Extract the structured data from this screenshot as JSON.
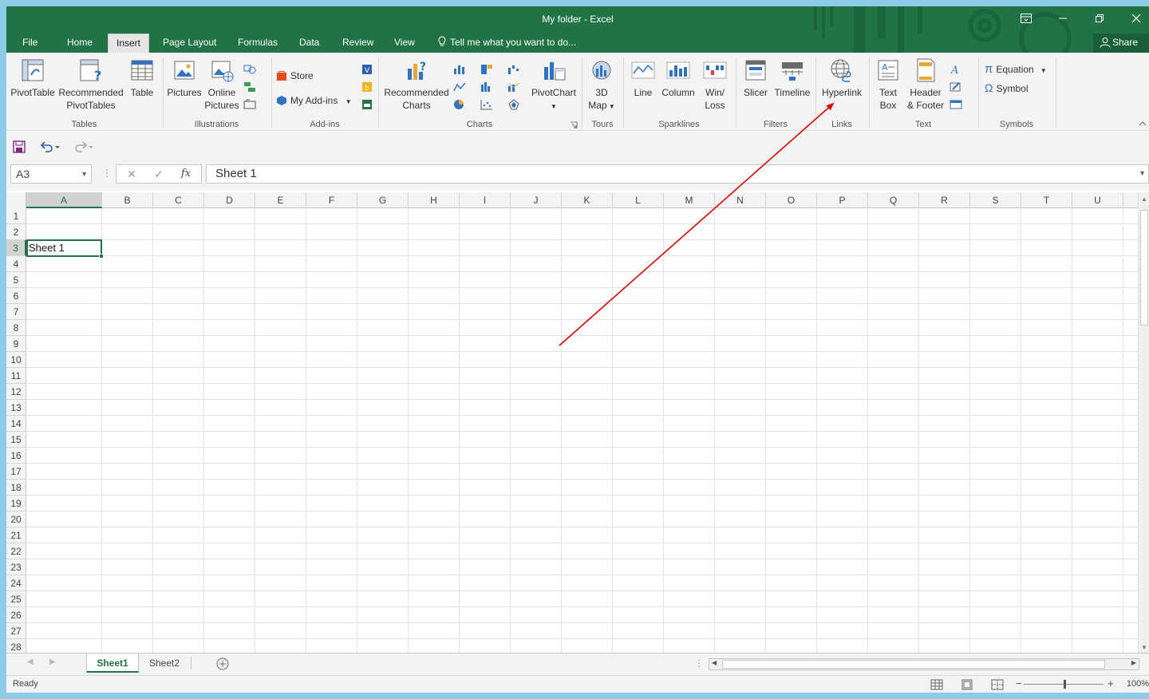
{
  "window": {
    "title": "My folder - Excel"
  },
  "tabs": [
    "File",
    "Home",
    "Insert",
    "Page Layout",
    "Formulas",
    "Data",
    "Review",
    "View"
  ],
  "active_tab": "Insert",
  "tell_me": "Tell me what you want to do...",
  "share_label": "Share",
  "ribbon": {
    "tables": {
      "group": "Tables",
      "pivot": "PivotTable",
      "rec_pivot_1": "Recommended",
      "rec_pivot_2": "PivotTables",
      "table": "Table"
    },
    "illustrations": {
      "group": "Illustrations",
      "pictures": "Pictures",
      "online_1": "Online",
      "online_2": "Pictures"
    },
    "addins": {
      "group": "Add-ins",
      "store": "Store",
      "my_addins": "My Add-ins"
    },
    "charts": {
      "group": "Charts",
      "rec_1": "Recommended",
      "rec_2": "Charts",
      "pivotchart": "PivotChart"
    },
    "tours": {
      "group": "Tours",
      "map_1": "3D",
      "map_2": "Map"
    },
    "sparklines": {
      "group": "Sparklines",
      "line": "Line",
      "column": "Column",
      "winloss_1": "Win/",
      "winloss_2": "Loss"
    },
    "filters": {
      "group": "Filters",
      "slicer": "Slicer",
      "timeline": "Timeline"
    },
    "links": {
      "group": "Links",
      "hyperlink": "Hyperlink"
    },
    "text": {
      "group": "Text",
      "textbox_1": "Text",
      "textbox_2": "Box",
      "header_1": "Header",
      "header_2": "& Footer"
    },
    "symbols": {
      "group": "Symbols",
      "equation": "Equation",
      "symbol": "Symbol"
    }
  },
  "formula_bar": {
    "name_box": "A3",
    "fx": "fx",
    "value": "Sheet 1"
  },
  "columns": [
    "A",
    "B",
    "C",
    "D",
    "E",
    "F",
    "G",
    "H",
    "I",
    "J",
    "K",
    "L",
    "M",
    "N",
    "O",
    "P",
    "Q",
    "R",
    "S",
    "T",
    "U"
  ],
  "rows": [
    "1",
    "2",
    "3",
    "4",
    "5",
    "6",
    "7",
    "8",
    "9",
    "10",
    "11",
    "12",
    "13",
    "14",
    "15",
    "16",
    "17",
    "18",
    "19",
    "20",
    "21",
    "22",
    "23",
    "24",
    "25",
    "26",
    "27",
    "28"
  ],
  "cells": {
    "A3": "Sheet 1"
  },
  "sheets": [
    "Sheet1",
    "Sheet2"
  ],
  "active_sheet": "Sheet1",
  "status": {
    "ready": "Ready",
    "zoom": "100%"
  },
  "colors": {
    "excel_green": "#217346",
    "annotation_arrow": "#e00000"
  }
}
